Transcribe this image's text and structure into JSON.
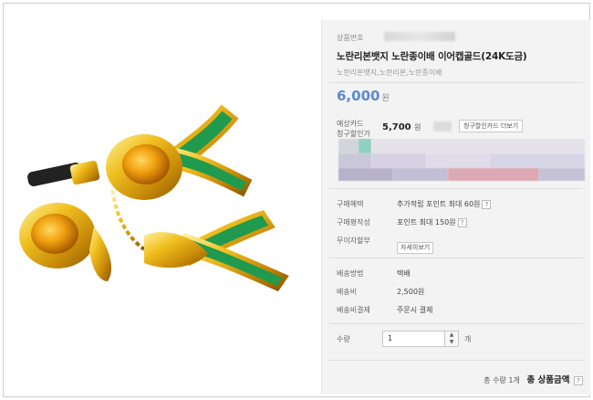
{
  "product": {
    "number_label": "상품번호",
    "title": "노란리본뱃지 노란종이배 이어캡골드(24K도금)",
    "subtitle": "노란리본뱃지,노란리본,노란종이배",
    "price_value": "6,000",
    "price_unit": "원"
  },
  "card_discount": {
    "label_line1": "예상카드",
    "label_line2": "청구할인가",
    "price_value": "5,700",
    "price_unit": "원",
    "more_button": "청구할인카드 더보기"
  },
  "benefits": {
    "purchase_benefit_label": "구매혜택",
    "purchase_benefit_value": "추가적립 포인트 최대 60원",
    "review_label": "구매평작성",
    "review_value": "포인트 최대 150원",
    "installment_label": "무이자할부",
    "installment_button": "자세히보기"
  },
  "shipping": {
    "method_label": "배송방법",
    "method_value": "택배",
    "fee_label": "배송비",
    "fee_value": "2,500원",
    "payment_label": "배송비결제",
    "payment_value": "주문시 결제"
  },
  "quantity": {
    "label": "수량",
    "value": "1",
    "unit": "개"
  },
  "total": {
    "qty_text": "총 수량 1개",
    "amount_label": "총 상품금액"
  },
  "colors": {
    "price_blue": "#5b8ad0",
    "panel_bg": "#f3f3f3",
    "gold": "#e0a810",
    "ribbon_green": "#1f9a4e"
  }
}
